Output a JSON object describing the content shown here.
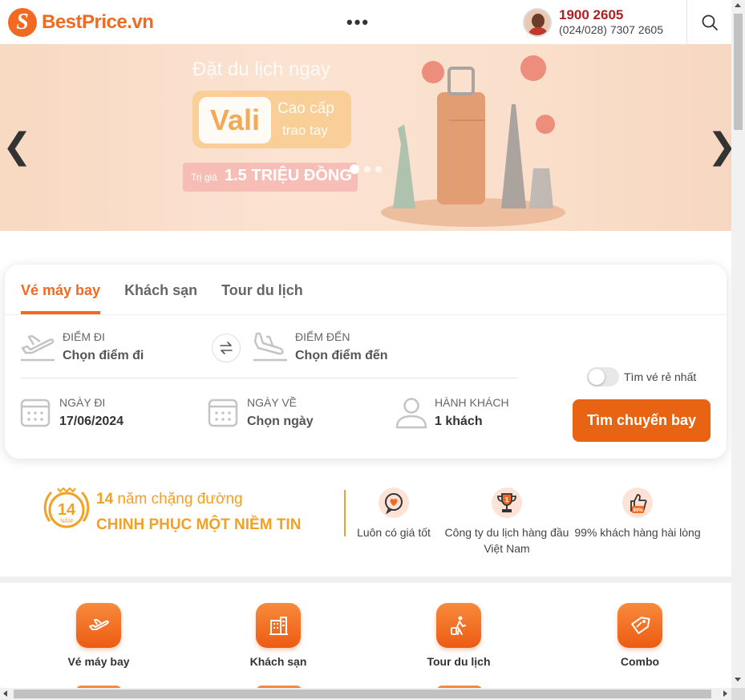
{
  "header": {
    "logo_text": "BestPrice.vn",
    "logo_glyph": "S",
    "more_dots": "•••",
    "hotline": "1900 2605",
    "phone_secondary": "(024/028) 7307 2605"
  },
  "banner": {
    "headline": "Đặt du lịch ngay",
    "vali": "Vali",
    "vali_sub1": "Cao cấp",
    "vali_sub2": "trao tay",
    "price_prefix": "Trị giá",
    "price_value": "1.5 TRIỆU ĐỒNG",
    "prev_arrow": "❮",
    "next_arrow": "❯",
    "slide_count": 3,
    "active_slide": 1
  },
  "search": {
    "tabs": [
      {
        "label": "Vé máy bay",
        "active": true
      },
      {
        "label": "Khách sạn",
        "active": false
      },
      {
        "label": "Tour du lịch",
        "active": false
      }
    ],
    "from": {
      "label": "ĐIỂM ĐI",
      "value": "Chọn điểm đi"
    },
    "to": {
      "label": "ĐIỂM ĐẾN",
      "value": "Chọn điểm đến"
    },
    "depart": {
      "label": "NGÀY ĐI",
      "value": "17/06/2024"
    },
    "return": {
      "label": "NGÀY VỀ",
      "value": "Chọn ngày"
    },
    "passengers": {
      "label": "HÀNH KHÁCH",
      "value": "1 khách"
    },
    "cheapest_toggle_label": "Tìm vé rẻ nhất",
    "cheapest_toggle_on": false,
    "submit_label": "Tìm chuyến bay"
  },
  "trust": {
    "badge_number": "14",
    "badge_word": "NĂM",
    "title_number": "14",
    "title_rest": " năm chặng đường",
    "subtitle": "CHINH PHỤC MỘT NIỀM TIN",
    "usps": [
      {
        "icon": "heart-chat-icon",
        "text": "Luôn có giá tốt"
      },
      {
        "icon": "trophy-icon",
        "text": "Công ty du lịch hàng đầu Việt Nam"
      },
      {
        "icon": "thumbs-up-icon",
        "text": "99% khách hàng hài lòng",
        "badge": "99%"
      }
    ]
  },
  "services": [
    {
      "label": "Vé máy bay",
      "icon": "plane-icon"
    },
    {
      "label": "Khách sạn",
      "icon": "hotel-icon"
    },
    {
      "label": "Tour du lịch",
      "icon": "traveler-icon"
    },
    {
      "label": "Combo",
      "icon": "tag-icon"
    }
  ],
  "colors": {
    "brand_orange": "#f26a21",
    "cta_orange": "#e86412",
    "hotline_red": "#b01f24",
    "gold": "#f3a023"
  }
}
